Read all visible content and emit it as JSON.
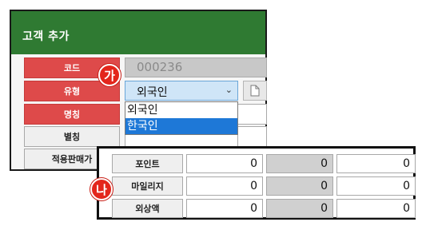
{
  "dialog": {
    "title": "고객 추가"
  },
  "form": {
    "labels": {
      "code": "코드",
      "type": "유형",
      "name": "명칭",
      "alias": "별칭",
      "price": "적용판매가"
    },
    "code_value": "000236",
    "type_value": "외국인",
    "type_options": [
      "외국인",
      "한국인"
    ],
    "type_highlighted": "한국인"
  },
  "badges": {
    "a": "가",
    "b": "나"
  },
  "balances": {
    "rows": [
      {
        "label": "포인트",
        "values": [
          "0",
          "0",
          "0"
        ]
      },
      {
        "label": "마일리지",
        "values": [
          "0",
          "0",
          "0"
        ]
      },
      {
        "label": "외상액",
        "values": [
          "0",
          "0",
          "0"
        ]
      }
    ]
  },
  "colors": {
    "header_green": "#2f7a32",
    "required_red": "#de4a4a",
    "badge_red": "#e3261c",
    "select_highlight": "#1e78d7"
  },
  "icons": {
    "dropdown": "chevron-down-icon",
    "document": "document-icon"
  }
}
